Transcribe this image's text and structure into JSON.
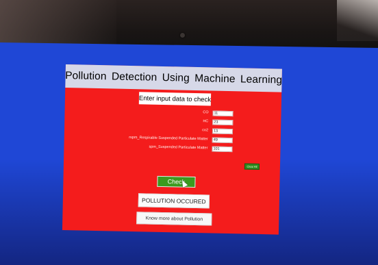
{
  "app": {
    "title": "Pollution  Detection Using Machine Learning",
    "subtitle": "Enter input data to check"
  },
  "fields": [
    {
      "label": "CO",
      "value": "11"
    },
    {
      "label": "HC",
      "value": "23"
    },
    {
      "label": "co2",
      "value": "13"
    },
    {
      "label": "rspm_Respirable Suspended Particulate Matter",
      "value": "49"
    },
    {
      "label": "spm_Suspended Particulate Matter",
      "value": "101"
    }
  ],
  "buttons": {
    "clear_label": "Clear All",
    "check_label": "Check",
    "know_more_label": "Know more about Pollution"
  },
  "result": {
    "text": "POLLUTION OCCURED"
  },
  "colors": {
    "desktop": "#1f47d6",
    "window": "#f41c1c",
    "title_bar": "#d6d8e8",
    "check_button": "#3b9a1f"
  },
  "icons": {
    "cursor": "mouse-pointer-icon",
    "camera": "webcam-icon"
  }
}
